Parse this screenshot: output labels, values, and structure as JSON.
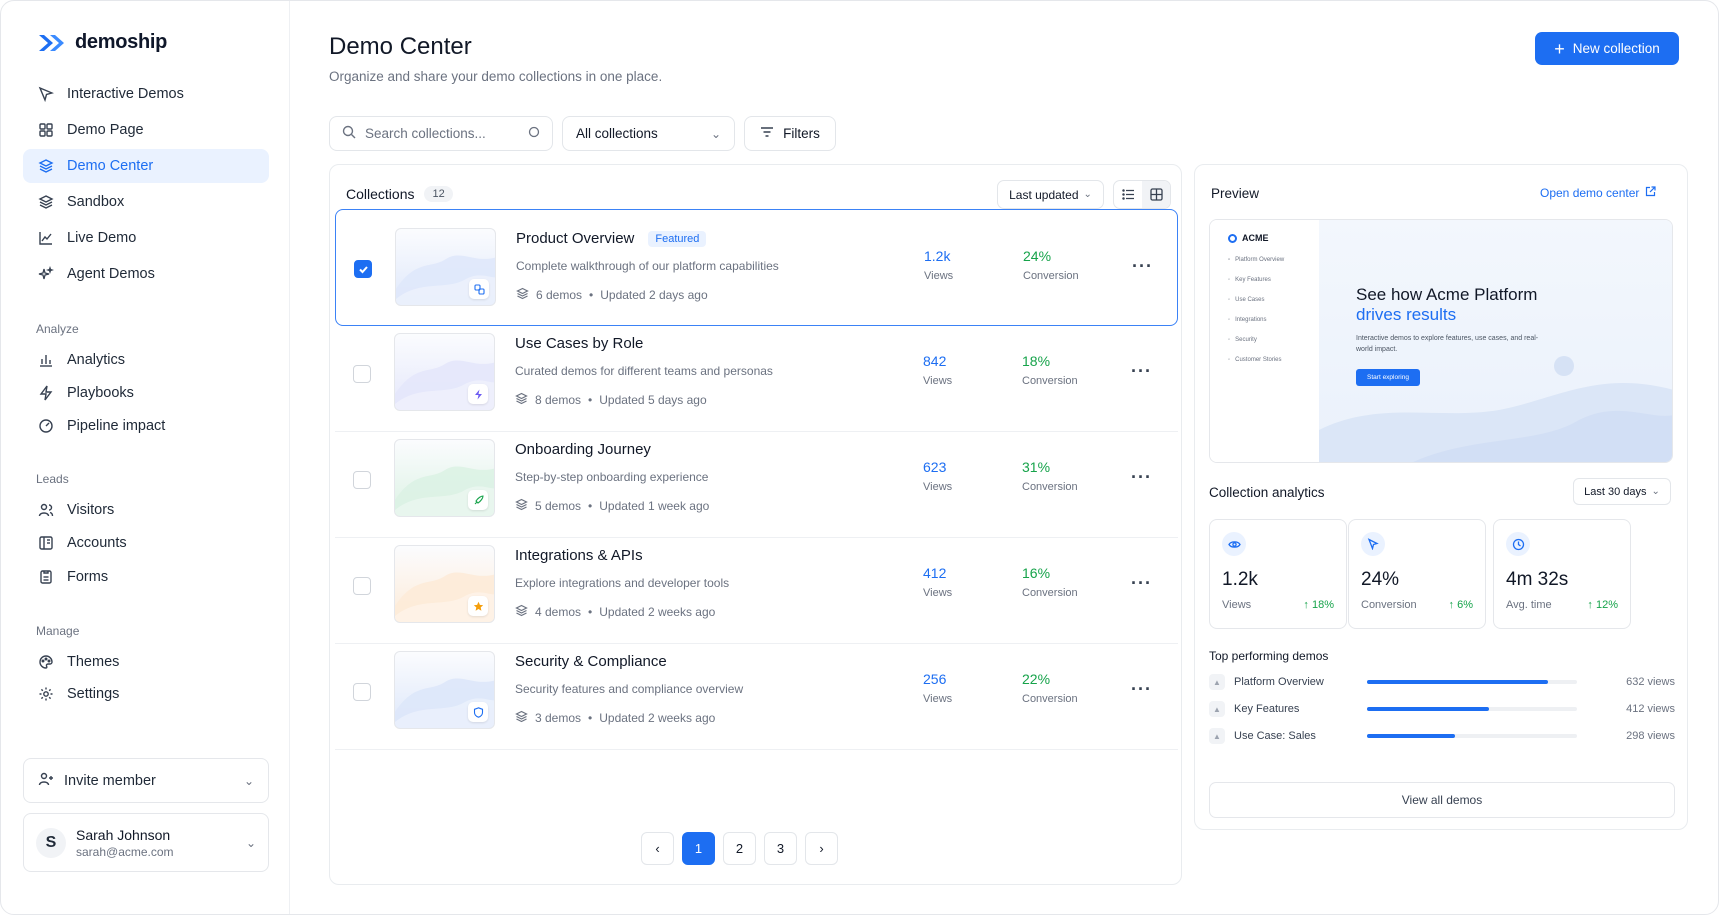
{
  "app": {
    "name": "demoship"
  },
  "sidebar": {
    "items": [
      {
        "label": "Interactive Demos",
        "icon": "cursor-icon"
      },
      {
        "label": "Demo Page",
        "icon": "grid-icon"
      },
      {
        "label": "Demo Center",
        "icon": "layers-icon",
        "active": true
      },
      {
        "label": "Sandbox",
        "icon": "layers-icon"
      },
      {
        "label": "Live Demo",
        "icon": "chart-line-icon"
      },
      {
        "label": "Agent Demos",
        "icon": "sparkle-icon"
      }
    ],
    "analyze_label": "Analyze",
    "analyze": [
      {
        "label": "Analytics",
        "icon": "bar-chart-icon"
      },
      {
        "label": "Playbooks",
        "icon": "bolt-icon"
      },
      {
        "label": "Pipeline impact",
        "icon": "gauge-icon"
      }
    ],
    "leads_label": "Leads",
    "leads": [
      {
        "label": "Visitors",
        "icon": "users-icon"
      },
      {
        "label": "Accounts",
        "icon": "building-icon"
      },
      {
        "label": "Forms",
        "icon": "form-icon"
      }
    ],
    "manage_label": "Manage",
    "manage": [
      {
        "label": "Themes",
        "icon": "palette-icon"
      },
      {
        "label": "Settings",
        "icon": "gear-icon"
      }
    ],
    "invite_label": "Invite member",
    "user": {
      "initial": "S",
      "name": "Sarah Johnson",
      "email": "sarah@acme.com"
    }
  },
  "header": {
    "title": "Demo Center",
    "subtitle": "Organize and share your demo collections in one place.",
    "new_button": "New collection"
  },
  "toolbar": {
    "search_placeholder": "Search collections...",
    "filter_select": "All collections",
    "filters_label": "Filters"
  },
  "collections": {
    "title": "Collections",
    "count": "12",
    "sort_label": "Last updated",
    "rows": [
      {
        "title": "Product Overview",
        "badge": "Featured",
        "desc": "Complete walkthrough of our platform capabilities",
        "demos": "6 demos",
        "updated": "Updated 2 days ago",
        "views": "1.2k",
        "views_label": "Views",
        "conversion": "24%",
        "conversion_label": "Conversion",
        "checked": true,
        "icon": "translate-icon",
        "theme": "#dfe8fb"
      },
      {
        "title": "Use Cases by Role",
        "badge": "",
        "desc": "Curated demos for different teams and personas",
        "demos": "8 demos",
        "updated": "Updated 5 days ago",
        "views": "842",
        "views_label": "Views",
        "conversion": "18%",
        "conversion_label": "Conversion",
        "checked": false,
        "icon": "bolt-icon",
        "theme": "#e4e7fb"
      },
      {
        "title": "Onboarding Journey",
        "badge": "",
        "desc": "Step-by-step onboarding experience",
        "demos": "5 demos",
        "updated": "Updated 1 week ago",
        "views": "623",
        "views_label": "Views",
        "conversion": "31%",
        "conversion_label": "Conversion",
        "checked": false,
        "icon": "rocket-icon",
        "theme": "#dcf2e4"
      },
      {
        "title": "Integrations & APIs",
        "badge": "",
        "desc": "Explore integrations and developer tools",
        "demos": "4 demos",
        "updated": "Updated 2 weeks ago",
        "views": "412",
        "views_label": "Views",
        "conversion": "16%",
        "conversion_label": "Conversion",
        "checked": false,
        "icon": "star-icon",
        "theme": "#fdebd8"
      },
      {
        "title": "Security & Compliance",
        "badge": "",
        "desc": "Security features and compliance overview",
        "demos": "3 demos",
        "updated": "Updated 2 weeks ago",
        "views": "256",
        "views_label": "Views",
        "conversion": "22%",
        "conversion_label": "Conversion",
        "checked": false,
        "icon": "shield-icon",
        "theme": "#dde7fa"
      }
    ],
    "pages": [
      "1",
      "2",
      "3"
    ],
    "current_page": "1"
  },
  "preview": {
    "title": "Preview",
    "open_link": "Open demo center",
    "brand": "ACME",
    "nav": [
      "Platform Overview",
      "Key Features",
      "Use Cases",
      "Integrations",
      "Security",
      "Customer Stories"
    ],
    "heading_1": "See how Acme Platform",
    "heading_2": "drives results",
    "body": "Interactive demos to explore features, use cases, and real-world impact.",
    "cta": "Start exploring"
  },
  "analytics": {
    "title": "Collection analytics",
    "range": "Last 30 days",
    "stats": [
      {
        "value": "1.2k",
        "label": "Views",
        "delta": "↑ 18%",
        "icon": "eye-icon"
      },
      {
        "value": "24%",
        "label": "Conversion",
        "delta": "↑ 6%",
        "icon": "cursor-icon"
      },
      {
        "value": "4m 32s",
        "label": "Avg. time",
        "delta": "↑ 12%",
        "icon": "clock-icon"
      }
    ],
    "top_title": "Top performing demos",
    "top": [
      {
        "name": "Platform Overview",
        "views": "632 views",
        "share": 0.86
      },
      {
        "name": "Key Features",
        "views": "412 views",
        "share": 0.58
      },
      {
        "name": "Use Case: Sales",
        "views": "298 views",
        "share": 0.42
      }
    ],
    "view_all": "View all demos"
  },
  "colors": {
    "accent": "#1d6ef2",
    "positive": "#16a34a",
    "active_bg": "#eaf2ff"
  }
}
